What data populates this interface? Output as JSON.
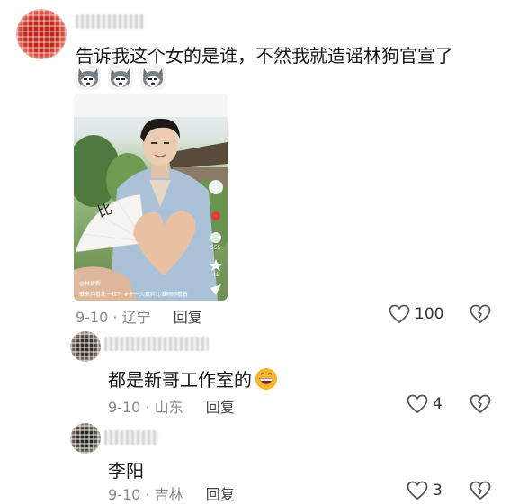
{
  "colors": {
    "background": "#ffffff",
    "text": "#161616",
    "meta": "#8a8a8a",
    "reply": "#444444"
  },
  "main_comment": {
    "text": "告诉我这个女的是谁，不然我就造谣林狗官宣了",
    "emojis": [
      "husky-emoji",
      "husky-emoji",
      "husky-emoji"
    ],
    "video": {
      "author": "@林更新",
      "caption": "谁来狗看比一拉？ #十一大嘉宾比谁刚刚看着",
      "fan_text": "比",
      "side_counts": [
        "555",
        "41"
      ]
    },
    "date": "9-10",
    "location": "辽宁",
    "reply_label": "回复",
    "like_count": "100"
  },
  "replies": [
    {
      "text": "都是新哥工作室的",
      "emoji": "grinning-face-emoji",
      "date": "9-10",
      "location": "山东",
      "reply_label": "回复",
      "like_count": "4"
    },
    {
      "text": "李阳",
      "date": "9-10",
      "location": "吉林",
      "reply_label": "回复",
      "like_count": "3"
    }
  ]
}
